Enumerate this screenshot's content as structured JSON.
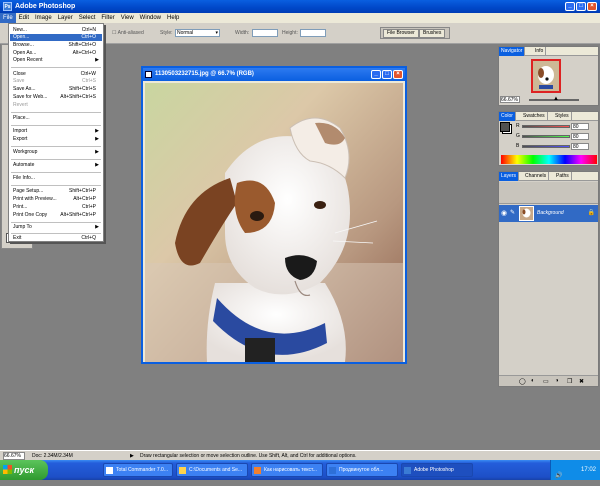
{
  "app": {
    "title": "Adobe Photoshop"
  },
  "menubar": {
    "items": [
      "File",
      "Edit",
      "Image",
      "Layer",
      "Select",
      "Filter",
      "View",
      "Window",
      "Help"
    ]
  },
  "options": {
    "anti_alias": "Anti-aliased",
    "style_label": "Style:",
    "style_value": "Normal",
    "width_label": "Width:",
    "height_label": "Height:",
    "file_browser_tab": "File Browser",
    "brushes_tab": "Brushes"
  },
  "file_menu": {
    "items": [
      {
        "label": "New...",
        "shortcut": "Ctrl+N"
      },
      {
        "label": "Open...",
        "shortcut": "Ctrl+O"
      },
      {
        "label": "Browse...",
        "shortcut": "Shift+Ctrl+O"
      },
      {
        "label": "Open As...",
        "shortcut": "Alt+Ctrl+O"
      },
      {
        "label": "Open Recent",
        "shortcut": ""
      },
      {
        "label": "Close",
        "shortcut": "Ctrl+W"
      },
      {
        "label": "Save",
        "shortcut": "Ctrl+S"
      },
      {
        "label": "Save As...",
        "shortcut": "Shift+Ctrl+S"
      },
      {
        "label": "Save for Web...",
        "shortcut": "Alt+Shift+Ctrl+S"
      },
      {
        "label": "Revert",
        "shortcut": ""
      },
      {
        "label": "Place...",
        "shortcut": ""
      },
      {
        "label": "Import",
        "shortcut": ""
      },
      {
        "label": "Export",
        "shortcut": ""
      },
      {
        "label": "Workgroup",
        "shortcut": ""
      },
      {
        "label": "Automate",
        "shortcut": ""
      },
      {
        "label": "File Info...",
        "shortcut": ""
      },
      {
        "label": "Page Setup...",
        "shortcut": "Shift+Ctrl+P"
      },
      {
        "label": "Print with Preview...",
        "shortcut": "Alt+Ctrl+P"
      },
      {
        "label": "Print...",
        "shortcut": "Ctrl+P"
      },
      {
        "label": "Print One Copy",
        "shortcut": "Alt+Shift+Ctrl+P"
      },
      {
        "label": "Jump To",
        "shortcut": ""
      },
      {
        "label": "Exit",
        "shortcut": "Ctrl+Q"
      }
    ]
  },
  "document": {
    "title": "1130503232715.jpg @ 66.7% (RGB)"
  },
  "navigator": {
    "tab1": "Navigator",
    "tab2": "Info",
    "zoom": "66.67%"
  },
  "color_palette": {
    "tab1": "Color",
    "tab2": "Swatches",
    "tab3": "Styles",
    "r_label": "R",
    "g_label": "G",
    "b_label": "B",
    "r": "80",
    "g": "80",
    "b": "80"
  },
  "layers_palette": {
    "tab1": "Layers",
    "tab2": "Channels",
    "tab3": "Paths",
    "layer_name": "Background"
  },
  "status": {
    "zoom": "66.67%",
    "doc": "Doc: 2.34M/2.34M",
    "hint": "Draw rectangular selection or move selection outline. Use Shift, Alt, and Ctrl for additional options."
  },
  "taskbar": {
    "start": "пуск",
    "buttons": [
      "Total Commander 7.0...",
      "C:\\Documents and Se...",
      "Как нарисовать текст...",
      "Продвинутое обл...",
      "Adobe Photoshop"
    ],
    "clock": "17:02"
  }
}
